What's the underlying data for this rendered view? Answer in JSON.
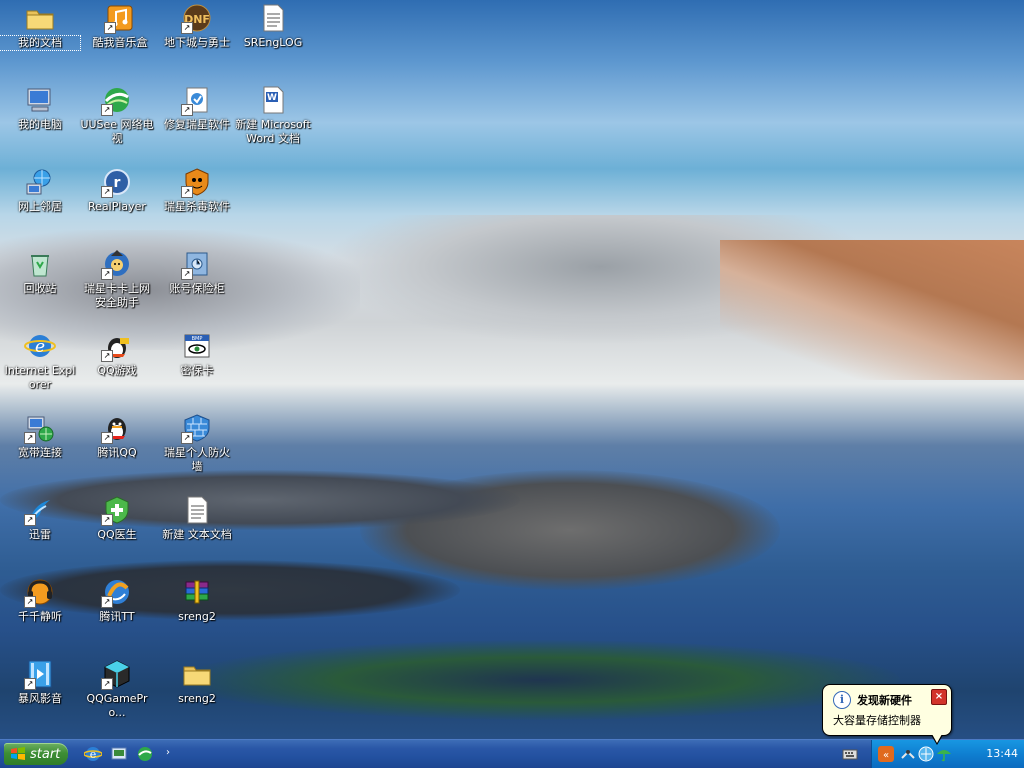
{
  "desktop": {
    "icons": [
      {
        "label": "我的文档",
        "glyph": "folder"
      },
      {
        "label": "酷我音乐盒",
        "glyph": "music-box"
      },
      {
        "label": "地下城与勇士",
        "glyph": "game"
      },
      {
        "label": "SREngLOG",
        "glyph": "text-doc"
      },
      {
        "label": "我的电脑",
        "glyph": "computer"
      },
      {
        "label": "UUSee 网络电视",
        "glyph": "tv"
      },
      {
        "label": "修复瑞星软件",
        "glyph": "repair"
      },
      {
        "label": "新建 Microsoft Word 文档",
        "glyph": "word-doc"
      },
      {
        "label": "网上邻居",
        "glyph": "network"
      },
      {
        "label": "RealPlayer",
        "glyph": "realplayer"
      },
      {
        "label": "瑞星杀毒软件",
        "glyph": "antivirus"
      },
      {
        "label": "回收站",
        "glyph": "recycle-bin"
      },
      {
        "label": "瑞星卡卡上网安全助手",
        "glyph": "assistant"
      },
      {
        "label": "账号保险柜",
        "glyph": "safe"
      },
      {
        "label": "Internet Explorer",
        "glyph": "ie"
      },
      {
        "label": "QQ游戏",
        "glyph": "qq-game"
      },
      {
        "label": "密保卡",
        "glyph": "card"
      },
      {
        "label": "宽带连接",
        "glyph": "broadband"
      },
      {
        "label": "腾讯QQ",
        "glyph": "qq"
      },
      {
        "label": "瑞星个人防火墙",
        "glyph": "firewall"
      },
      {
        "label": "迅雷",
        "glyph": "thunder"
      },
      {
        "label": "QQ医生",
        "glyph": "qq-doctor"
      },
      {
        "label": "新建 文本文档",
        "glyph": "text-doc"
      },
      {
        "label": "千千静听",
        "glyph": "ttplayer"
      },
      {
        "label": "腾讯TT",
        "glyph": "tt"
      },
      {
        "label": "sreng2",
        "glyph": "archive"
      },
      {
        "label": "暴风影音",
        "glyph": "storm-player"
      },
      {
        "label": "QQGamePro...",
        "glyph": "cube"
      },
      {
        "label": "sreng2",
        "glyph": "folder"
      }
    ]
  },
  "taskbar": {
    "start_label": "start",
    "clock": "13:44"
  },
  "balloon": {
    "title": "发现新硬件",
    "body": "大容量存储控制器",
    "close_glyph": "×",
    "info_glyph": "i"
  }
}
